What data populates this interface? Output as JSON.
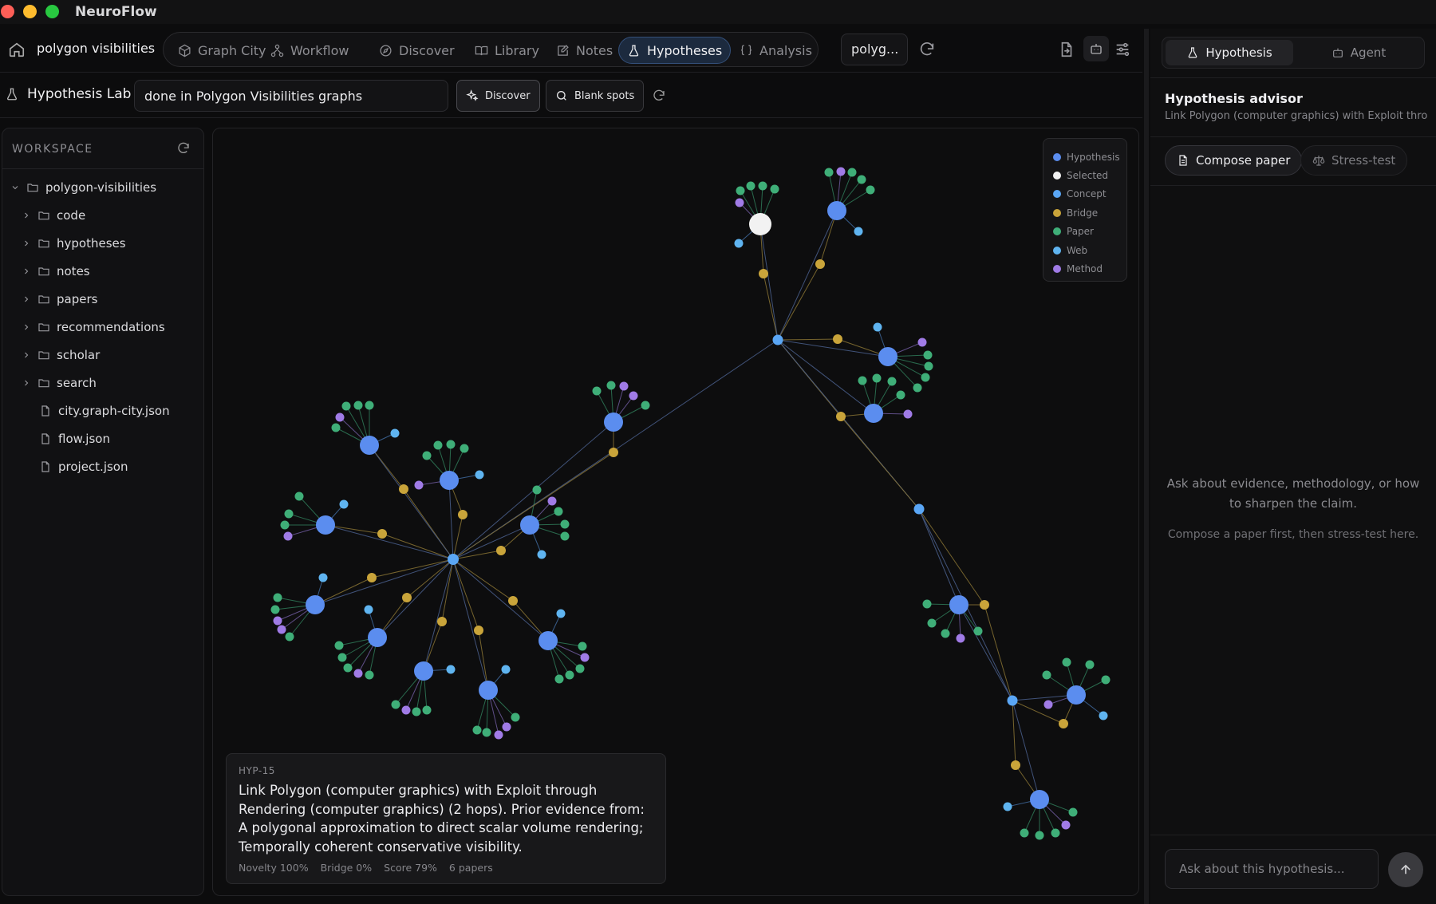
{
  "app": {
    "title": "NeuroFlow"
  },
  "nav": {
    "project": "polygon visibilities",
    "tabs": [
      {
        "label": "Graph City",
        "icon": "cube-icon"
      },
      {
        "label": "Workflow",
        "icon": "workflow-icon"
      },
      {
        "label": "Discover",
        "icon": "compass-icon"
      },
      {
        "label": "Library",
        "icon": "book-icon"
      },
      {
        "label": "Notes",
        "icon": "note-icon"
      },
      {
        "label": "Hypotheses",
        "icon": "flask-icon",
        "active": true
      },
      {
        "label": "Analysis",
        "icon": "braces-icon"
      }
    ],
    "project_select": "polyg..."
  },
  "lab": {
    "title": "Hypothesis Lab",
    "query": "done in Polygon Visibilities graphs",
    "discover_label": "Discover",
    "blank_spots_label": "Blank spots"
  },
  "workspace": {
    "header": "WORKSPACE",
    "root": "polygon-visibilities",
    "folders": [
      "code",
      "hypotheses",
      "notes",
      "papers",
      "recommendations",
      "scholar",
      "search"
    ],
    "files": [
      "city.graph-city.json",
      "flow.json",
      "project.json"
    ]
  },
  "legend": [
    {
      "label": "Hypothesis",
      "color": "#5b8def"
    },
    {
      "label": "Selected",
      "color": "#f2f2f2"
    },
    {
      "label": "Concept",
      "color": "#5aa6f5"
    },
    {
      "label": "Bridge",
      "color": "#c9a43a"
    },
    {
      "label": "Paper",
      "color": "#3fae78"
    },
    {
      "label": "Web",
      "color": "#5fb4f0"
    },
    {
      "label": "Method",
      "color": "#a07be6"
    }
  ],
  "hypothesis": {
    "id": "HYP-15",
    "text": "Link Polygon (computer graphics) with Exploit through Rendering (computer graphics) (2 hops). Prior evidence from: A polygonal approximation to direct scalar volume rendering; Temporally coherent conservative visibility.",
    "novelty": "Novelty 100%",
    "bridge": "Bridge 0%",
    "score": "Score 79%",
    "papers": "6 papers"
  },
  "right_panel": {
    "tabs": [
      "Hypothesis",
      "Agent"
    ],
    "advisor_title": "Hypothesis advisor",
    "advisor_subtitle": "Link Polygon (computer graphics) with Exploit thro...",
    "compose_label": "Compose paper",
    "stress_label": "Stress-test",
    "empty_line1": "Ask about evidence, methodology, or how to sharpen the claim.",
    "empty_line2": "Compose a paper first, then stress-test here.",
    "ask_placeholder": "Ask about this hypothesis..."
  }
}
